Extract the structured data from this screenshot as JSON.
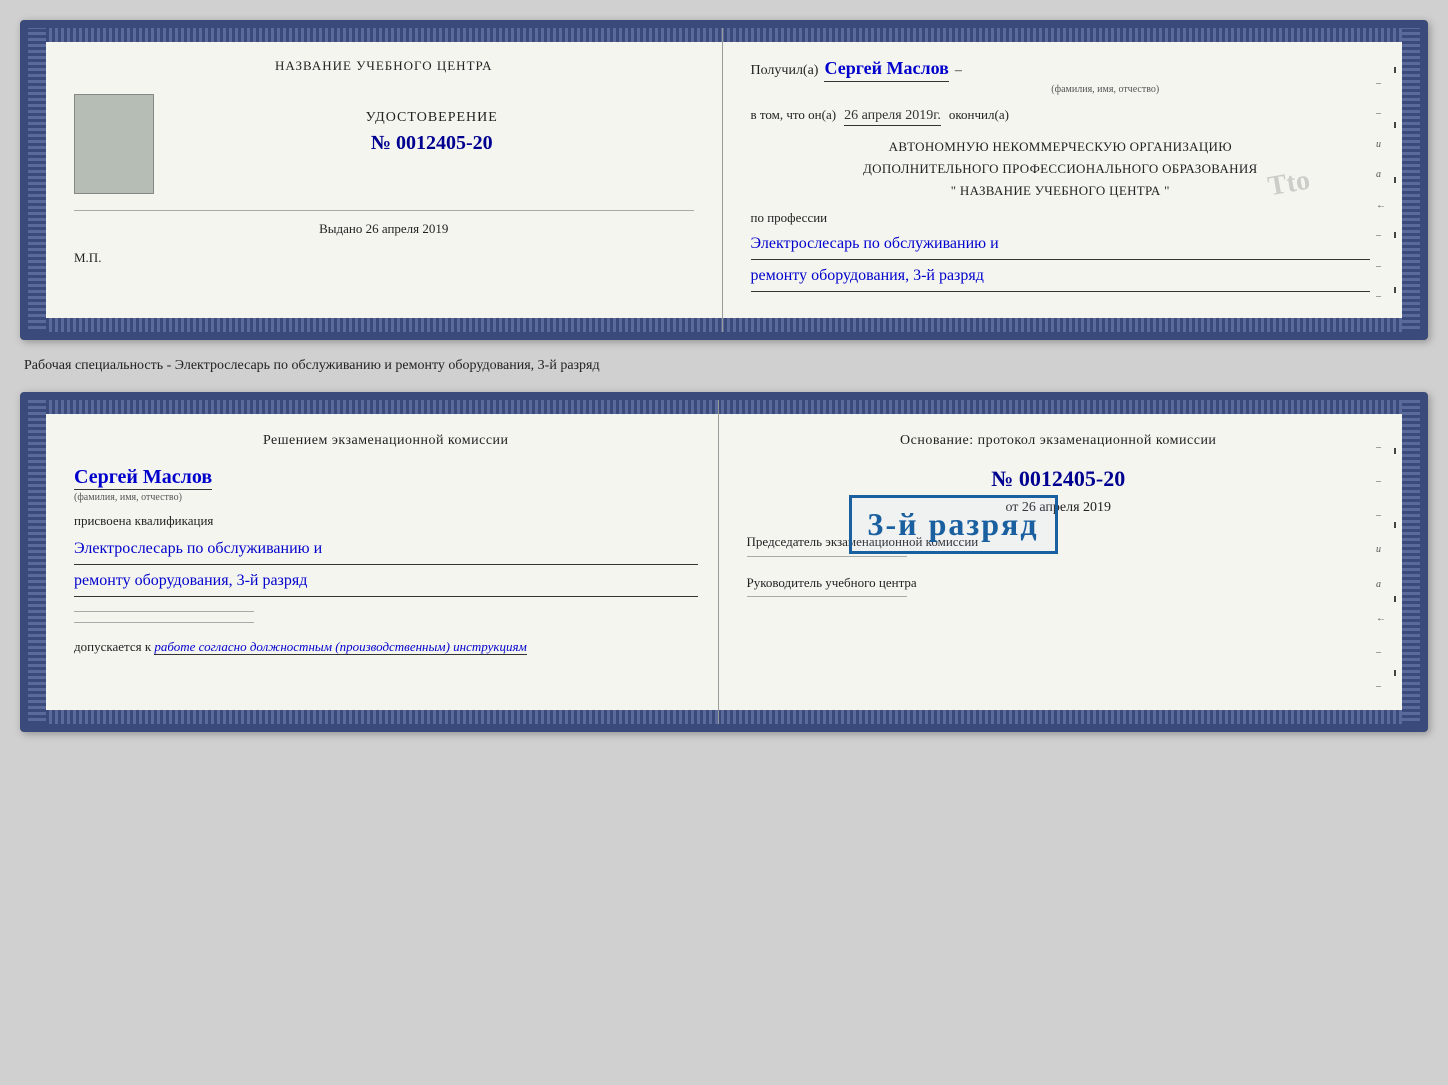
{
  "page": {
    "background": "#d0d0d0"
  },
  "cert1": {
    "left": {
      "orgTitle": "НАЗВАНИЕ УЧЕБНОГО ЦЕНТРА",
      "certLabel": "УДОСТОВЕРЕНИЕ",
      "certNumber": "№ 0012405-20",
      "issuedLabel": "Выдано",
      "issuedDate": "26 апреля 2019",
      "mpLabel": "М.П."
    },
    "right": {
      "receivedLabel": "Получил(а)",
      "recipientName": "Сергей Маслов",
      "nameSubtitle": "(фамилия, имя, отчество)",
      "dash": "–",
      "inThatLabel": "в том, что он(а)",
      "completionDate": "26 апреля 2019г.",
      "completedLabel": "окончил(а)",
      "orgBlock1": "АВТОНОМНУЮ НЕКОММЕРЧЕСКУЮ ОРГАНИЗАЦИЮ",
      "orgBlock2": "ДОПОЛНИТЕЛЬНОГО ПРОФЕССИОНАЛЬНОГО ОБРАЗОВАНИЯ",
      "orgBlock3": "\"   НАЗВАНИЕ УЧЕБНОГО ЦЕНТРА   \"",
      "professionLabel": "по профессии",
      "professionLine1": "Электрослесарь по обслуживанию и",
      "professionLine2": "ремонту оборудования, 3-й разряд"
    }
  },
  "betweenLabel": "Рабочая специальность - Электрослесарь по обслуживанию и ремонту оборудования, 3-й разряд",
  "cert2": {
    "left": {
      "decisionLabel": "Решением экзаменационной комиссии",
      "personName": "Сергей Маслов",
      "nameSubtitle": "(фамилия, имя, отчество)",
      "qualificationLabel": "присвоена квалификация",
      "qualLine1": "Электрослесарь по обслуживанию и",
      "qualLine2": "ремонту оборудования, 3-й разряд",
      "admissionLabel": "допускается к",
      "admissionText": "работе согласно должностным (производственным) инструкциям"
    },
    "right": {
      "basisLabel": "Основание: протокол экзаменационной комиссии",
      "protocolNumber": "№ 0012405-20",
      "dateLabel": "от",
      "protocolDate": "26 апреля 2019",
      "chairmanLabel": "Председатель экзаменационной комиссии",
      "headLabel": "Руководитель учебного центра"
    },
    "stamp": {
      "text": "3-й разряд"
    }
  }
}
